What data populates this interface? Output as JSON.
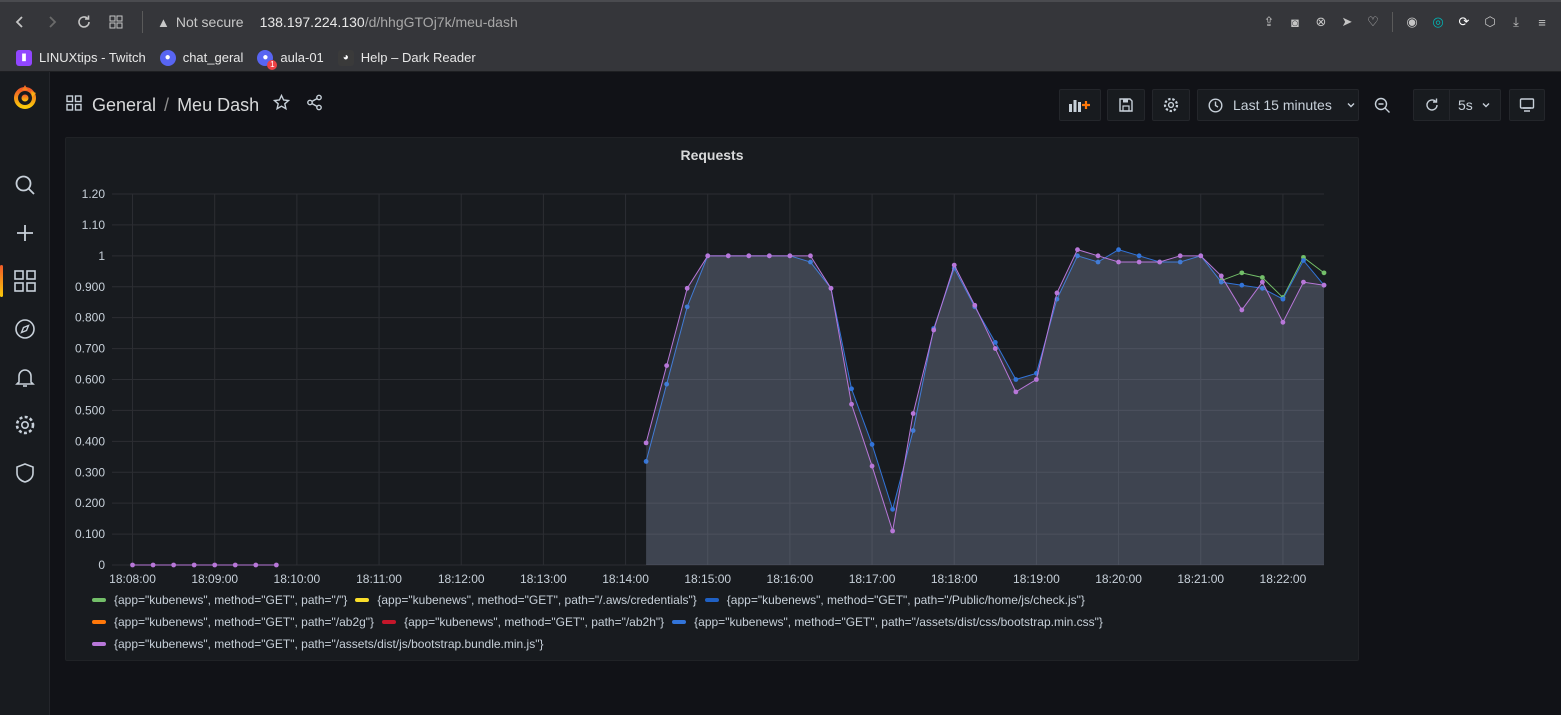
{
  "browser": {
    "security_label": "Not secure",
    "url_host": "138.197.224.130",
    "url_path": "/d/hhgGTOj7k/meu-dash",
    "bookmarks": [
      {
        "label": "LINUXtips - Twitch",
        "icon": "twitch-icon",
        "color": "#9146ff"
      },
      {
        "label": "chat_geral",
        "icon": "discord-icon",
        "color": "#5865f2"
      },
      {
        "label": "aula-01",
        "icon": "discord-icon",
        "color": "#5865f2",
        "badge": "1"
      },
      {
        "label": "Help – Dark Reader",
        "icon": "dark-reader-icon",
        "color": "#777777"
      }
    ]
  },
  "dashboard": {
    "folder": "General",
    "title": "Meu Dash",
    "time_range": "Last 15 minutes",
    "refresh": "5s"
  },
  "panel": {
    "title": "Requests"
  },
  "colors": {
    "accent": "#f05a28",
    "green": "#73bf69",
    "yellow": "#fade2a",
    "dark_blue": "#1f60c4",
    "orange": "#ff780a",
    "red": "#c4162a",
    "blue": "#3274d9",
    "purple": "#8f3bb8"
  },
  "chart_data": {
    "type": "area",
    "title": "Requests",
    "y_ticks": [
      "0",
      "0.100",
      "0.200",
      "0.300",
      "0.400",
      "0.500",
      "0.600",
      "0.700",
      "0.800",
      "0.900",
      "1",
      "1.10",
      "1.20"
    ],
    "ylim": [
      0,
      1.2
    ],
    "x_ticks": [
      "18:08:00",
      "18:09:00",
      "18:10:00",
      "18:11:00",
      "18:12:00",
      "18:13:00",
      "18:14:00",
      "18:15:00",
      "18:16:00",
      "18:17:00",
      "18:18:00",
      "18:19:00",
      "18:20:00",
      "18:21:00",
      "18:22:00"
    ],
    "x_start": "18:07:45",
    "x_end": "18:22:30",
    "grid": true,
    "legend": "bottom",
    "series": [
      {
        "name": "{app=\"kubenews\", method=\"GET\", path=\"/\"}",
        "color": "#73bf69",
        "x": [
          "18:21:15",
          "18:21:30",
          "18:21:45",
          "18:22:00",
          "18:22:15",
          "18:22:30"
        ],
        "y": [
          0.92,
          0.945,
          0.93,
          0.865,
          0.995,
          0.945
        ]
      },
      {
        "name": "{app=\"kubenews\", method=\"GET\", path=\"/.aws/credentials\"}",
        "color": "#fade2a",
        "x": [],
        "y": []
      },
      {
        "name": "{app=\"kubenews\", method=\"GET\", path=\"/Public/home/js/check.js\"}",
        "color": "#1f60c4",
        "x": [],
        "y": []
      },
      {
        "name": "{app=\"kubenews\", method=\"GET\", path=\"/ab2g\"}",
        "color": "#ff780a",
        "x": [],
        "y": []
      },
      {
        "name": "{app=\"kubenews\", method=\"GET\", path=\"/ab2h\"}",
        "color": "#c4162a",
        "x": [],
        "y": []
      },
      {
        "name": "{app=\"kubenews\", method=\"GET\", path=\"/assets/dist/css/bootstrap.min.css\"}",
        "color": "#3274d9",
        "x": [
          "18:14:15",
          "18:14:30",
          "18:14:45",
          "18:15:00",
          "18:15:15",
          "18:15:30",
          "18:15:45",
          "18:16:00",
          "18:16:15",
          "18:16:30",
          "18:16:45",
          "18:17:00",
          "18:17:15",
          "18:17:30",
          "18:17:45",
          "18:18:00",
          "18:18:15",
          "18:18:30",
          "18:18:45",
          "18:19:00",
          "18:19:15",
          "18:19:30",
          "18:19:45",
          "18:20:00",
          "18:20:15",
          "18:20:30",
          "18:20:45",
          "18:21:00",
          "18:21:15",
          "18:21:30",
          "18:21:45",
          "18:22:00",
          "18:22:15",
          "18:22:30"
        ],
        "y": [
          0.335,
          0.585,
          0.835,
          1,
          1,
          1,
          1,
          1,
          0.98,
          0.895,
          0.57,
          0.39,
          0.18,
          0.435,
          0.765,
          0.96,
          0.835,
          0.72,
          0.6,
          0.62,
          0.86,
          1,
          0.98,
          1.02,
          1,
          0.98,
          0.98,
          1,
          0.915,
          0.905,
          0.895,
          0.86,
          0.985,
          0.905
        ]
      },
      {
        "name": "{app=\"kubenews\", method=\"GET\", path=\"/assets/dist/js/bootstrap.bundle.min.js\"}",
        "color": "#b877d9",
        "x": [
          "18:08:00",
          "18:08:15",
          "18:08:30",
          "18:08:45",
          "18:09:00",
          "18:09:15",
          "18:09:30",
          "18:09:45",
          "18:14:15",
          "18:14:30",
          "18:14:45",
          "18:15:00",
          "18:15:15",
          "18:15:30",
          "18:15:45",
          "18:16:00",
          "18:16:15",
          "18:16:30",
          "18:16:45",
          "18:17:00",
          "18:17:15",
          "18:17:30",
          "18:17:45",
          "18:18:00",
          "18:18:15",
          "18:18:30",
          "18:18:45",
          "18:19:00",
          "18:19:15",
          "18:19:30",
          "18:19:45",
          "18:20:00",
          "18:20:15",
          "18:20:30",
          "18:20:45",
          "18:21:00",
          "18:21:15",
          "18:21:30",
          "18:21:45",
          "18:22:00",
          "18:22:15",
          "18:22:30"
        ],
        "y": [
          0,
          0,
          0,
          0,
          0,
          0,
          0,
          0,
          0.395,
          0.645,
          0.895,
          1,
          1,
          1,
          1,
          1,
          1,
          0.895,
          0.52,
          0.32,
          0.11,
          0.49,
          0.76,
          0.97,
          0.84,
          0.7,
          0.56,
          0.6,
          0.88,
          1.02,
          1,
          0.98,
          0.98,
          0.98,
          1,
          1,
          0.935,
          0.825,
          0.915,
          0.785,
          0.915,
          0.905
        ]
      }
    ]
  }
}
